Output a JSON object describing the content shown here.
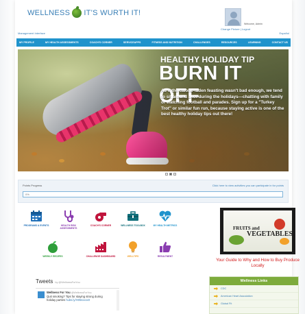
{
  "header": {
    "logo_left": "WELLNESS",
    "logo_right": "IT'S WURTH IT!",
    "welcome": "Welcome, Admin",
    "change_picture": "Change Picture",
    "logout": "Logout",
    "link_separator": "|",
    "management_interface": "Management Interface",
    "espanol": "Español"
  },
  "nav": {
    "items": [
      "MY PROFILE",
      "MY HEALTH ASSESSMENTS",
      "COACH'S CORNER",
      "SERVICEAPPS",
      "FITNESS AND NUTRITION",
      "CHALLENGES",
      "RESOURCES",
      "LEARNING",
      "CONTACT US"
    ]
  },
  "hero": {
    "kicker": "HEALTHY HOLIDAY TIP",
    "headline": "BURN IT OFF",
    "body": "As if the calorie-laden feasting wasn't bad enough, we tend to sit around a lot during the holidays—chatting with family or watching football and parades. Sign up for a \"Turkey Trot\" or similar fun run, because staying active is one of the best healthy holiday tips out there!",
    "slide_count": 3,
    "active_slide": 2
  },
  "points": {
    "label": "Points Progress",
    "link": "Click here to view activities you can participate in for points",
    "percent_text": "0%",
    "progress_fraction": 0.0
  },
  "tiles": [
    {
      "label": "PROGRAMS & EVENTS",
      "icon": "calendar-icon",
      "color": "#1f6fb8"
    },
    {
      "label": "HEALTH RISK ASSESSMENTS",
      "icon": "stethoscope-icon",
      "color": "#8a3db0"
    },
    {
      "label": "COACH'S CORNER",
      "icon": "whistle-icon",
      "color": "#c0143c"
    },
    {
      "label": "WELLNESS TOOLBOX",
      "icon": "toolbox-icon",
      "color": "#0f6e7a"
    },
    {
      "label": "MY HEALTH METRICS",
      "icon": "heart-pulse-icon",
      "color": "#1f93cc"
    },
    {
      "label": "WEEKLY RECIPES",
      "icon": "apple-icon",
      "color": "#2e9e3a"
    },
    {
      "label": "CHALLENGE DASHBOARD",
      "icon": "factory-icon",
      "color": "#c0143c"
    },
    {
      "label": "WELLTIPS",
      "icon": "lightbulb-icon",
      "color": "#f2a12a"
    },
    {
      "label": "RESULTMENT",
      "icon": "thumbs-up-icon",
      "color": "#8a3db0"
    }
  ],
  "video": {
    "title_small": "FRUITS and",
    "title_big": "VEGETABLES",
    "caption": "Your Guide to Why and How to Buy Produce Locally"
  },
  "tweets": {
    "title": "Tweets",
    "by": "by @WellnessForYou",
    "name": "Wellness For You",
    "handle": "@WellnessForYou",
    "text": "Quit smoking? Tips for staying strong during holiday parties",
    "link": "hubs.ly/H05sxxxx0"
  },
  "wellness_links": {
    "title": "Wellness Links",
    "items": [
      "CDC",
      "American Heart Association",
      "Global Fit"
    ]
  },
  "colors": {
    "nav_blue": "#1f93cc",
    "link_blue": "#3a7fb6",
    "links_green": "#7dab3c",
    "caption_red": "#d11a1a"
  }
}
